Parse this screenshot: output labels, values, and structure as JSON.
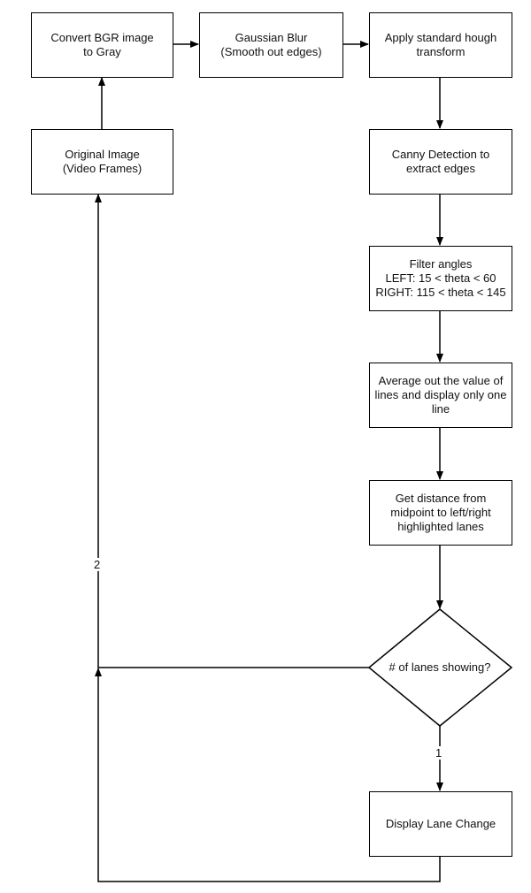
{
  "nodes": {
    "convert": "Convert BGR image\nto Gray",
    "blur": "Gaussian Blur\n(Smooth out edges)",
    "hough": "Apply standard hough\ntransform",
    "original": "Original Image\n(Video Frames)",
    "canny": "Canny Detection to\nextract edges",
    "filter": "Filter angles\nLEFT: 15 < theta < 60\nRIGHT: 115 < theta < 145",
    "average": "Average out the value of\nlines and display only one\nline",
    "distance": "Get distance from\nmidpoint to left/right\nhighlighted lanes",
    "decision": "# of lanes showing?",
    "display": "Display Lane Change"
  },
  "edge_labels": {
    "one": "1",
    "two": "2"
  }
}
